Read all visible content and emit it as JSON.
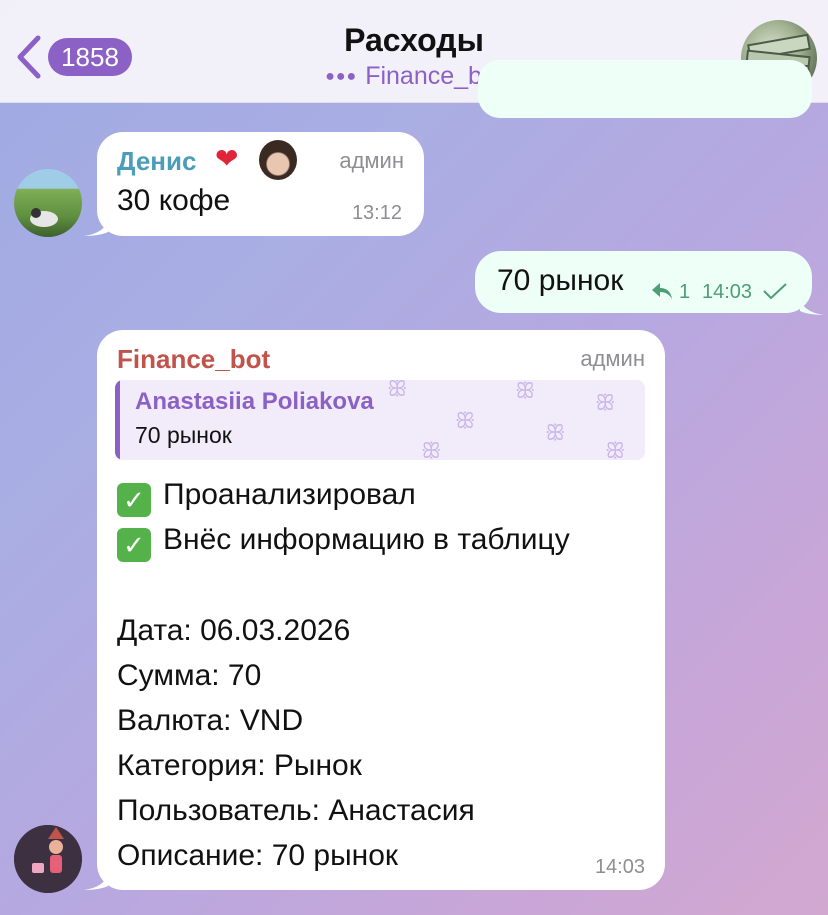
{
  "header": {
    "back_count": "1858",
    "title": "Расходы",
    "subtitle": "Finance_bot"
  },
  "messages": [
    {
      "sender": "Денис",
      "role": "админ",
      "text": "30 кофе",
      "time": "13:12"
    },
    {
      "text": "70 рынок",
      "replies": "1",
      "time": "14:03"
    },
    {
      "sender": "Finance_bot",
      "role": "админ",
      "quote": {
        "author": "Anastasiia Poliakova",
        "text": "70 рынок"
      },
      "lines": [
        "Проанализировал",
        "Внёс информацию в таблицу",
        "Дата: 06.03.2026",
        "Сумма: 70",
        "Валюта: VND",
        "Категория: Рынок",
        "Пользователь: Анастасия",
        "Описание: 70 рынок"
      ],
      "time": "14:03"
    }
  ],
  "colors": {
    "accent": "#8c61c6",
    "incoming": "#ffffff",
    "outgoing": "#eefff8",
    "denis_name": "#4c9db8",
    "bot_name": "#c0534b",
    "check": "#55b24a"
  }
}
